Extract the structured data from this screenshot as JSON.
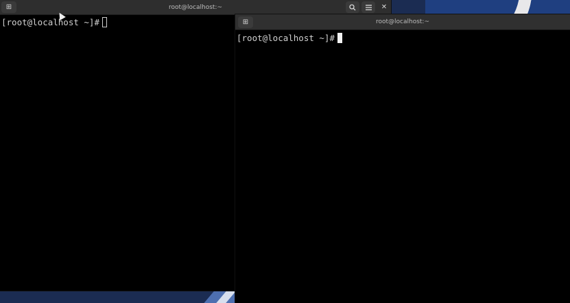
{
  "desktop": {
    "background_color": "#1b2c52"
  },
  "left_window": {
    "title": "root@localhost:~",
    "new_tab_icon": "plus-box-icon",
    "controls": {
      "search_icon": "search-icon",
      "menu_icon": "hamburger-menu-icon",
      "close_icon": "close-icon"
    },
    "prompt": "[root@localhost ~]#",
    "cursor_style": "hollow"
  },
  "right_window": {
    "title": "root@localhost:~",
    "new_tab_icon": "plus-box-icon",
    "prompt": "[root@localhost ~]#",
    "cursor_style": "solid"
  }
}
